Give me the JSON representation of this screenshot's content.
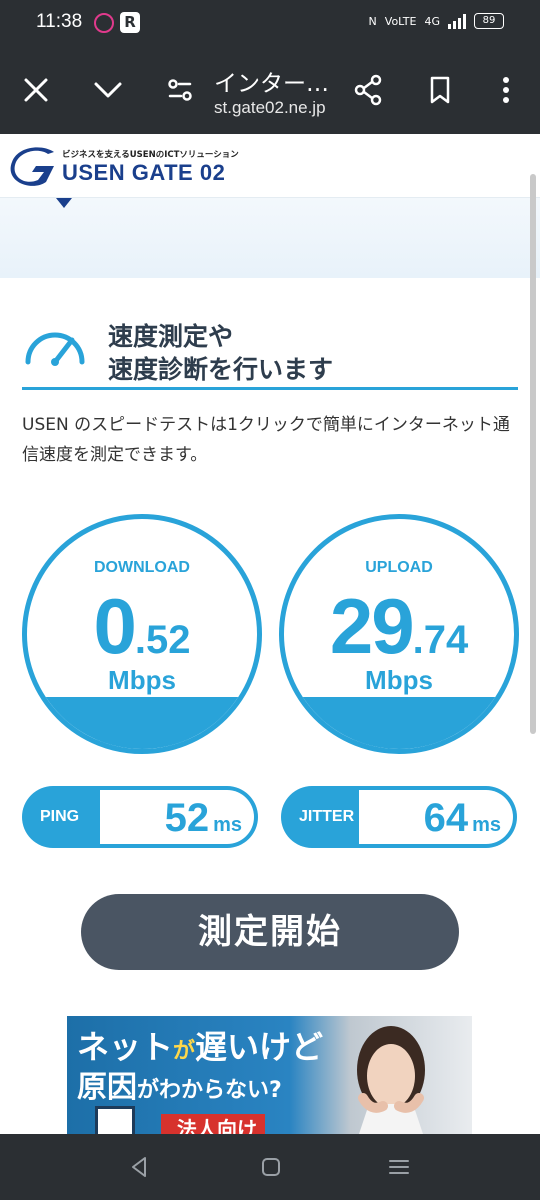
{
  "status_bar": {
    "time": "11:38",
    "network": "4G",
    "battery": "89"
  },
  "browser": {
    "title": "インター…",
    "host": "st.gate02.ne.jp"
  },
  "site": {
    "tagline": "ビジネスを支えるUSENのICTソリューション",
    "logo": "USEN GATE 02"
  },
  "section": {
    "heading_line1": "速度測定や",
    "heading_line2": "速度診断を行います",
    "description": "USEN のスピードテストは1クリックで簡単にインターネット通信速度を測定できます。"
  },
  "download": {
    "label": "DOWNLOAD",
    "int": "0",
    "dec": ".52",
    "unit": "Mbps"
  },
  "upload": {
    "label": "UPLOAD",
    "int": "29",
    "dec": ".74",
    "unit": "Mbps"
  },
  "ping": {
    "label": "PING",
    "value": "52",
    "unit": "ms"
  },
  "jitter": {
    "label": "JITTER",
    "value": "64",
    "unit": "ms"
  },
  "start_button": "測定開始",
  "ad": {
    "line1a": "ネット",
    "line1b": "が",
    "line1c": "遅いけど",
    "line2a": "原因",
    "line2b": "がわからない?",
    "tag": "法人向け"
  },
  "colors": {
    "accent": "#29a3d9",
    "brand": "#1a3f8c",
    "button": "#4a5563"
  }
}
